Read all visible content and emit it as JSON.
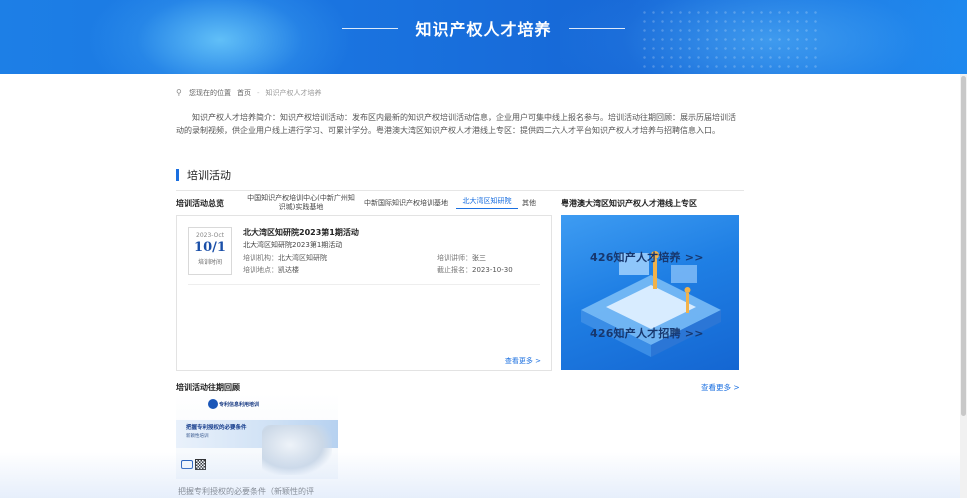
{
  "banner": {
    "title": "知识产权人才培养"
  },
  "breadcrumb": {
    "location_label": "您现在的位置",
    "home": "首页",
    "separator": "-",
    "current": "知识产权人才培养"
  },
  "intro": {
    "text": "知识产权人才培养简介：知识产权培训活动：发布区内最新的知识产权培训活动信息，企业用户可集中线上报名参与。培训活动往期回顾：展示历届培训活动的录制视频，供企业用户线上进行学习、可累计学分。粤港澳大湾区知识产权人才港线上专区：提供四二六人才平台知识产权人才培养与招聘信息入口。"
  },
  "section": {
    "title": "培训活动"
  },
  "tabs": {
    "overview_label": "培训活动总览",
    "items": [
      {
        "label": "中国知识产权培训中心(中新广州知识城)实践基地"
      },
      {
        "label": "中新国际知识产权培训基地"
      },
      {
        "label": "北大湾区知研院"
      },
      {
        "label": "其他"
      }
    ],
    "active_index": 2
  },
  "activity": {
    "date_ym": "2023-Oct",
    "date_md": "10/1",
    "date_label": "培训时间",
    "title": "北大湾区知研院2023第1期活动",
    "subtitle": "北大湾区知研院2023第1期活动",
    "org_label": "培训机构：",
    "org_value": "北大湾区知研院",
    "teacher_label": "培训讲师：",
    "teacher_value": "张三",
    "place_label": "培训地点：",
    "place_value": "凯达楼",
    "deadline_label": "截止报名：",
    "deadline_value": "2023-10-30",
    "more": "查看更多 >"
  },
  "gba": {
    "title": "粤港澳大湾区知识产权人才港线上专区",
    "promo_line1": "426知产人才培养 >>",
    "promo_line2": "426知产人才招聘 >>"
  },
  "review": {
    "title": "培训活动往期回顾",
    "more": "查看更多 >",
    "thumb": {
      "org": "专利信息利用培训",
      "headline": "把握专利授权的必要条件",
      "sub": "新颖性培训",
      "caption": "把握专利授权的必要条件（新颖性的评"
    }
  },
  "colors": {
    "accent": "#1a6fe0",
    "banner": "#1a74e0",
    "date_blue": "#1a4fa8"
  }
}
